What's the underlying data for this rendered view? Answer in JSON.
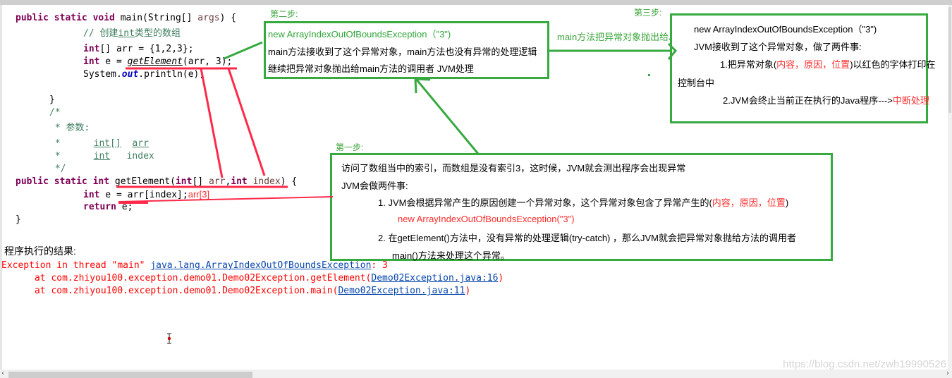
{
  "code": {
    "main_signature": [
      "public static void ",
      "main(String[] ",
      "args",
      ") {"
    ],
    "comment_create": "// 创建",
    "comment_int": "int",
    "comment_rest": "类型的数组",
    "line_arr": [
      " arr = {1,2,3};"
    ],
    "line_call": [
      " e = ",
      "getElement",
      "(arr, 3);"
    ],
    "line_print": [
      "System.",
      "out",
      ".println(e);"
    ],
    "close_brace": "}",
    "jdoc_open": "/*",
    "jdoc_params": " * 参数:",
    "jdoc_p1_star": " *      ",
    "jdoc_p1_type": "int[]",
    "jdoc_p1_name": "arr",
    "jdoc_p2_star": " *      ",
    "jdoc_p2_type": "int",
    "jdoc_p2_name": "index",
    "jdoc_close": " */",
    "get_signature": [
      "public static int ",
      "getElement(",
      "int",
      "[] ",
      "arr",
      ",",
      "int",
      " ",
      "index",
      ") {"
    ],
    "line_access": [
      " e = arr[index];"
    ],
    "access_annotation": "arr[3]",
    "line_return": [
      " e;"
    ],
    "kw_int": "int",
    "kw_return": "return"
  },
  "result": {
    "title": "程序执行的结果:",
    "exception_prefix": "Exception in thread \"main\" ",
    "exception_class": "java.lang.ArrayIndexOutOfBoundsException",
    "exception_suffix": ": 3",
    "trace": [
      {
        "prefix": "      at com.zhiyou100.exception.demo01.Demo02Exception.getElement(",
        "link": "Demo02Exception.java:16",
        "suffix": ")"
      },
      {
        "prefix": "      at com.zhiyou100.exception.demo01.Demo02Exception.main(",
        "link": "Demo02Exception.java:11",
        "suffix": ")"
      }
    ]
  },
  "steps": {
    "step1": {
      "label": "第一步:",
      "line1": "访问了数组当中的索引，而数组是没有索引3，这时候，JVM就会测出程序会出现异常",
      "line2": "JVM会做两件事:",
      "line3_prefix": "1.   JVM会根据异常产生的原因创建一个异常对象，这个异常对象包含了异常产生的(",
      "line3_red": "内容，原因，位置",
      "line3_suffix": ")",
      "line4": "new ArrayIndexOutOfBoundsException(\"3\")",
      "line5": "2.  在getElement()方法中，没有异常的处理逻辑(try-catch) ，那么JVM就会把异常对象抛给方法的调用者",
      "line6": "main()方法来处理这个异常。"
    },
    "step2": {
      "label": "第二步:",
      "line1": "new ArrayIndexOutOfBoundsException（\"3\")",
      "line2": "main方法接收到了这个异常对象，main方法也没有异常的处理逻辑",
      "line3": "继续把异常对象抛出给main方法的调用者  JVM处理"
    },
    "step3": {
      "label": "第三步:",
      "arrow_label": "main方法把异常对象抛出给JVM",
      "line1": "new ArrayIndexOutOfBoundsException（\"3\")",
      "line2": "JVM接收到了这个异常对象，做了两件事:",
      "line3_prefix": "1.把异常对象(",
      "line3_red": "内容，原因，位置",
      "line3_suffix": ")以红色的字体打印在",
      "line4": "控制台中",
      "line5_prefix": "2.JVM会终止当前正在执行的Java程序--->",
      "line5_red": "中断处理"
    }
  },
  "watermark": "https://blog.csdn.net/zwh19990526",
  "scroll": {
    "left_arrow": "‹",
    "right_arrow": "›"
  },
  "colors": {
    "box_border": "#36a93f",
    "annotation_red": "#ff2a2a",
    "keyword": "#7f0055",
    "comment": "#3f7f5f"
  }
}
